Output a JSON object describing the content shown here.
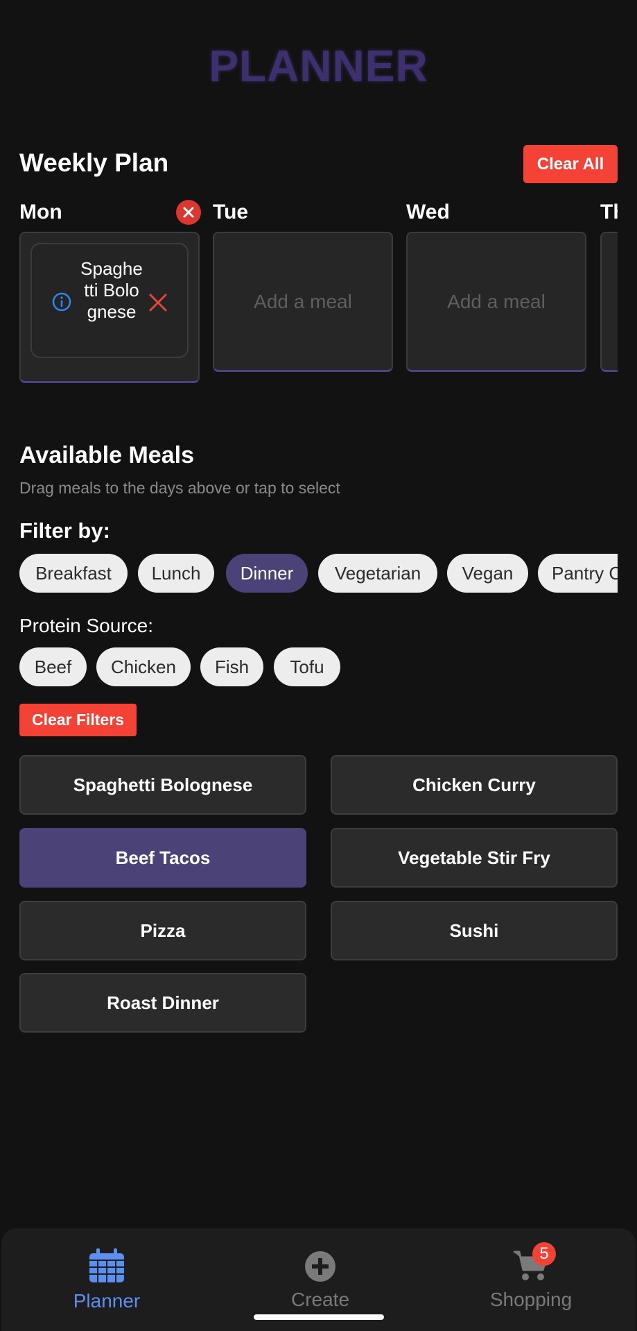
{
  "app": {
    "title": "PLANNER"
  },
  "weekly": {
    "title": "Weekly Plan",
    "clear_all_label": "Clear All",
    "days": [
      {
        "label": "Mon",
        "meal": "Spaghetti Bolognese"
      },
      {
        "label": "Tue",
        "placeholder": "Add a meal"
      },
      {
        "label": "Wed",
        "placeholder": "Add a meal"
      },
      {
        "label": "Th"
      }
    ]
  },
  "available": {
    "title": "Available Meals",
    "subtitle": "Drag meals to the days above or tap to select"
  },
  "filters": {
    "label": "Filter by:",
    "meal_types": [
      "Breakfast",
      "Lunch",
      "Dinner",
      "Vegetarian",
      "Vegan",
      "Pantry C"
    ],
    "active_meal_type": "Dinner",
    "protein_label": "Protein Source:",
    "proteins": [
      "Beef",
      "Chicken",
      "Fish",
      "Tofu"
    ],
    "clear_label": "Clear Filters"
  },
  "meals": [
    "Spaghetti Bolognese",
    "Chicken Curry",
    "Beef Tacos",
    "Vegetable Stir Fry",
    "Pizza",
    "Sushi",
    "Roast Dinner"
  ],
  "selected_meal": "Beef Tacos",
  "nav": {
    "items": [
      {
        "label": "Planner",
        "icon": "calendar-icon",
        "active": true
      },
      {
        "label": "Create",
        "icon": "plus-circle-icon"
      },
      {
        "label": "Shopping",
        "icon": "cart-icon",
        "badge": "5"
      }
    ]
  },
  "colors": {
    "accent": "#4b4377",
    "danger": "#f44336",
    "nav_active": "#5b8ff0"
  }
}
